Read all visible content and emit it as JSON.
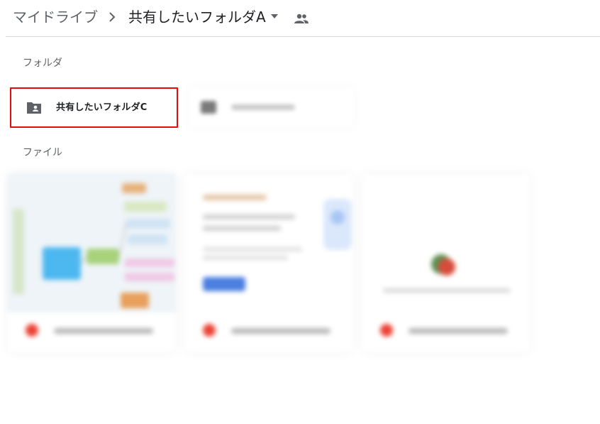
{
  "breadcrumb": {
    "root": "マイドライブ",
    "current": "共有したいフォルダA"
  },
  "sections": {
    "folders_label": "フォルダ",
    "files_label": "ファイル"
  },
  "folders": [
    {
      "name": "共有したいフォルダC",
      "icon": "shared-folder-icon"
    }
  ],
  "colors": {
    "highlight_border": "#e30b0b",
    "divider": "#dadce0",
    "muted_text": "#5f6368",
    "pdf_red": "#ea4335"
  }
}
